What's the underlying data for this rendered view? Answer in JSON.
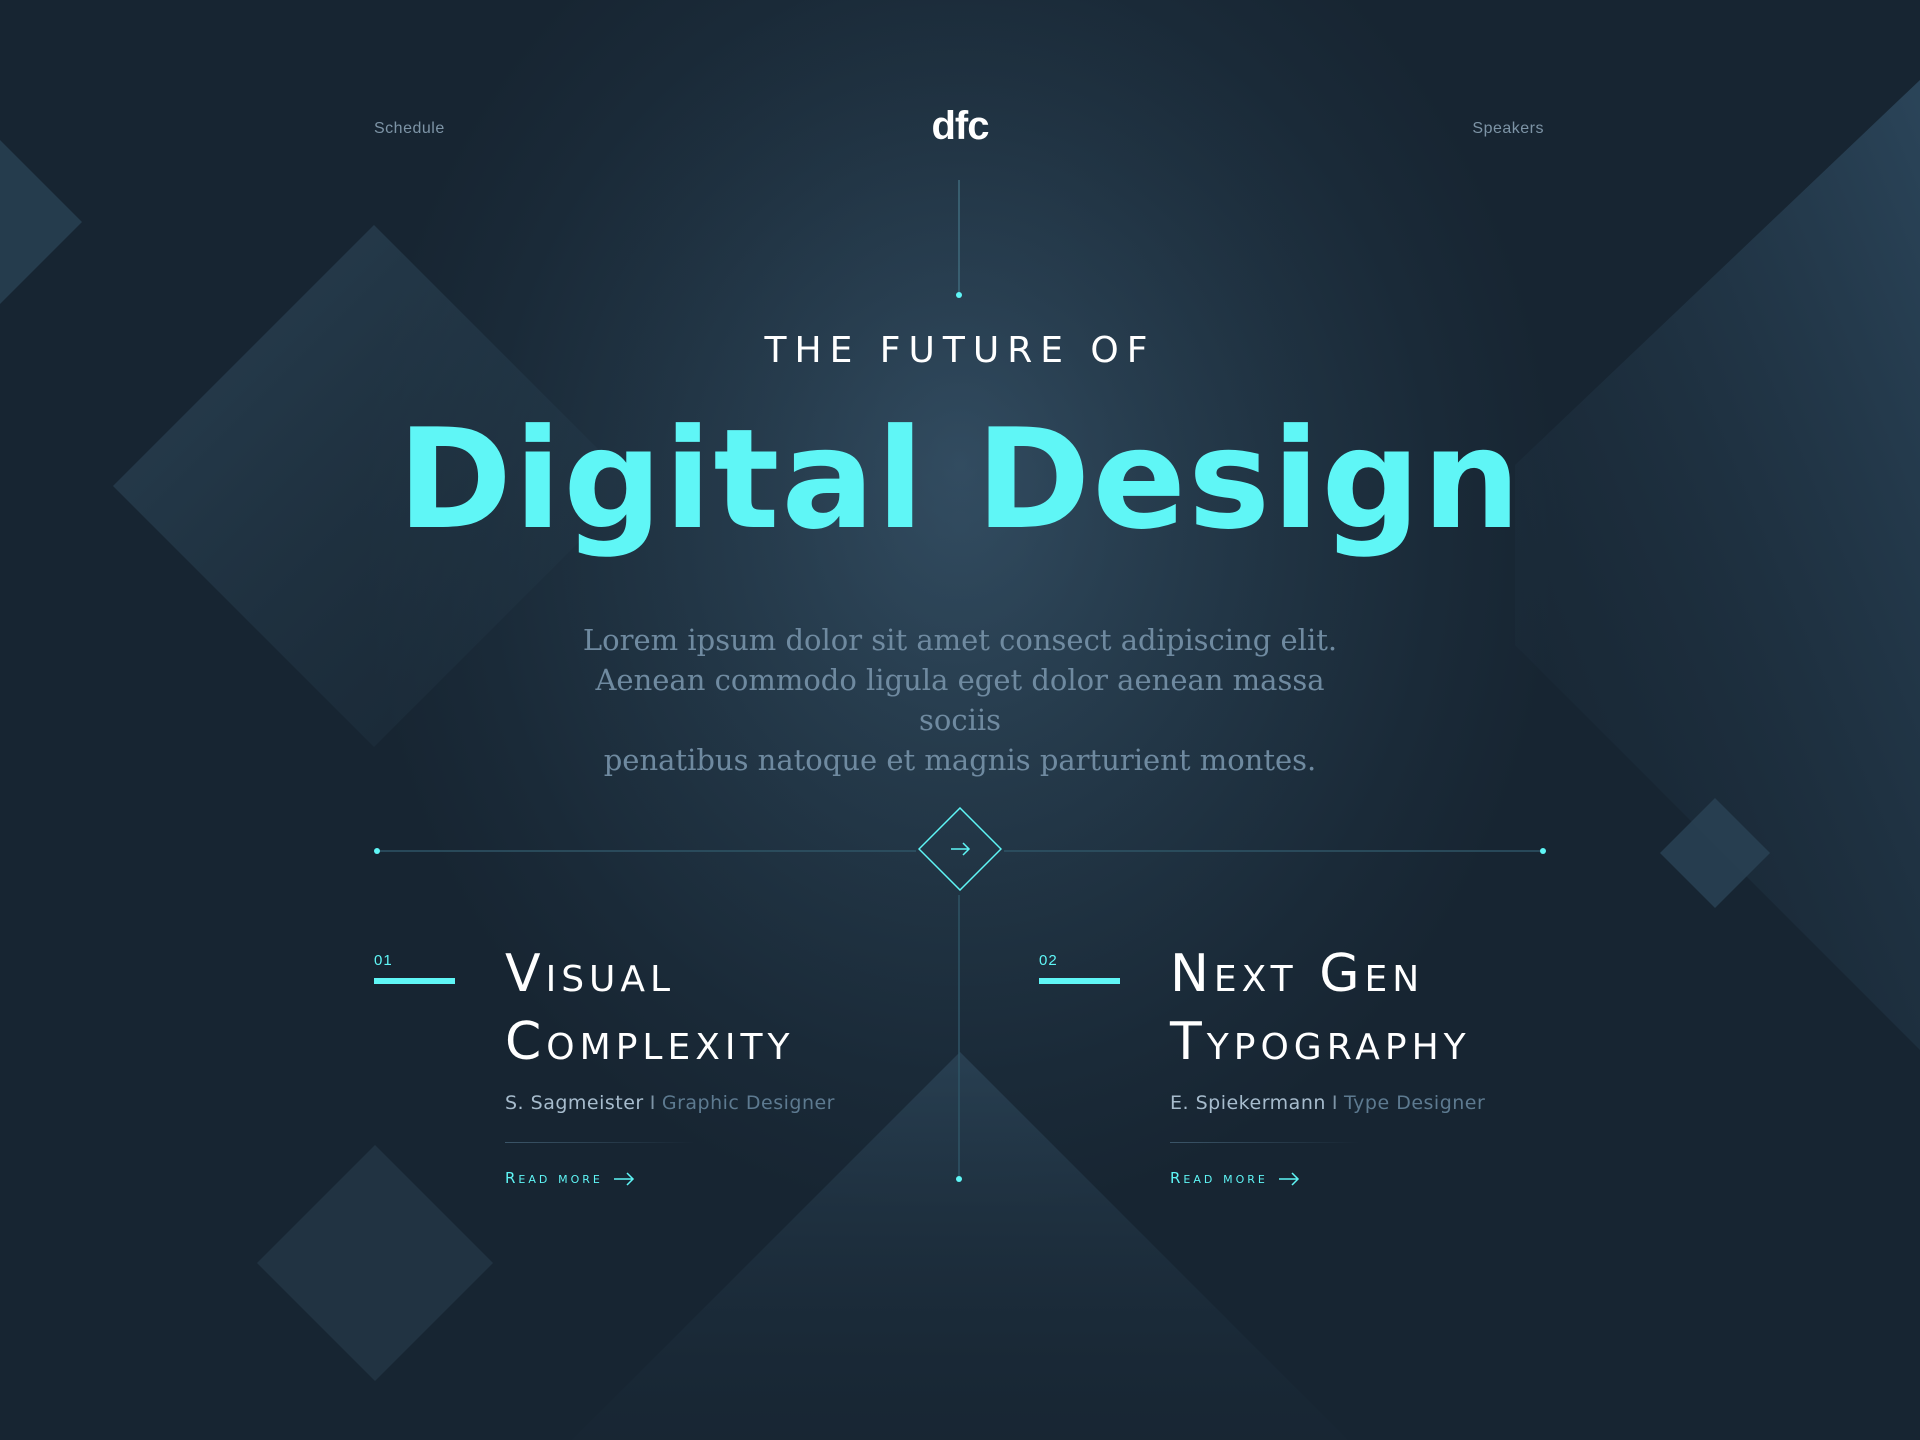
{
  "nav": {
    "schedule": "Schedule",
    "logo": "dfc",
    "speakers": "Speakers"
  },
  "hero": {
    "eyebrow": "THE FUTURE OF",
    "headline": "Digital Design",
    "lede_lines": [
      "Lorem ipsum dolor sit amet consect adipiscing elit.",
      "Aenean commodo ligula eget dolor aenean massa sociis",
      "penatibus natoque et magnis parturient montes."
    ]
  },
  "next_button_icon": "arrow-right-icon",
  "talks": [
    {
      "number": "01",
      "title_lines": [
        "Visual",
        "Complexity"
      ],
      "speaker": "S. Sagmeister",
      "separator": "I",
      "role": "Graphic Designer",
      "cta": "Read more"
    },
    {
      "number": "02",
      "title_lines": [
        "Next Gen",
        "Typography"
      ],
      "speaker": "E. Spiekermann",
      "separator": "I",
      "role": "Type Designer",
      "cta": "Read more"
    }
  ],
  "colors": {
    "accent": "#5ff6f6",
    "background": "#1a2a38",
    "muted_text": "#6f8aa0"
  }
}
